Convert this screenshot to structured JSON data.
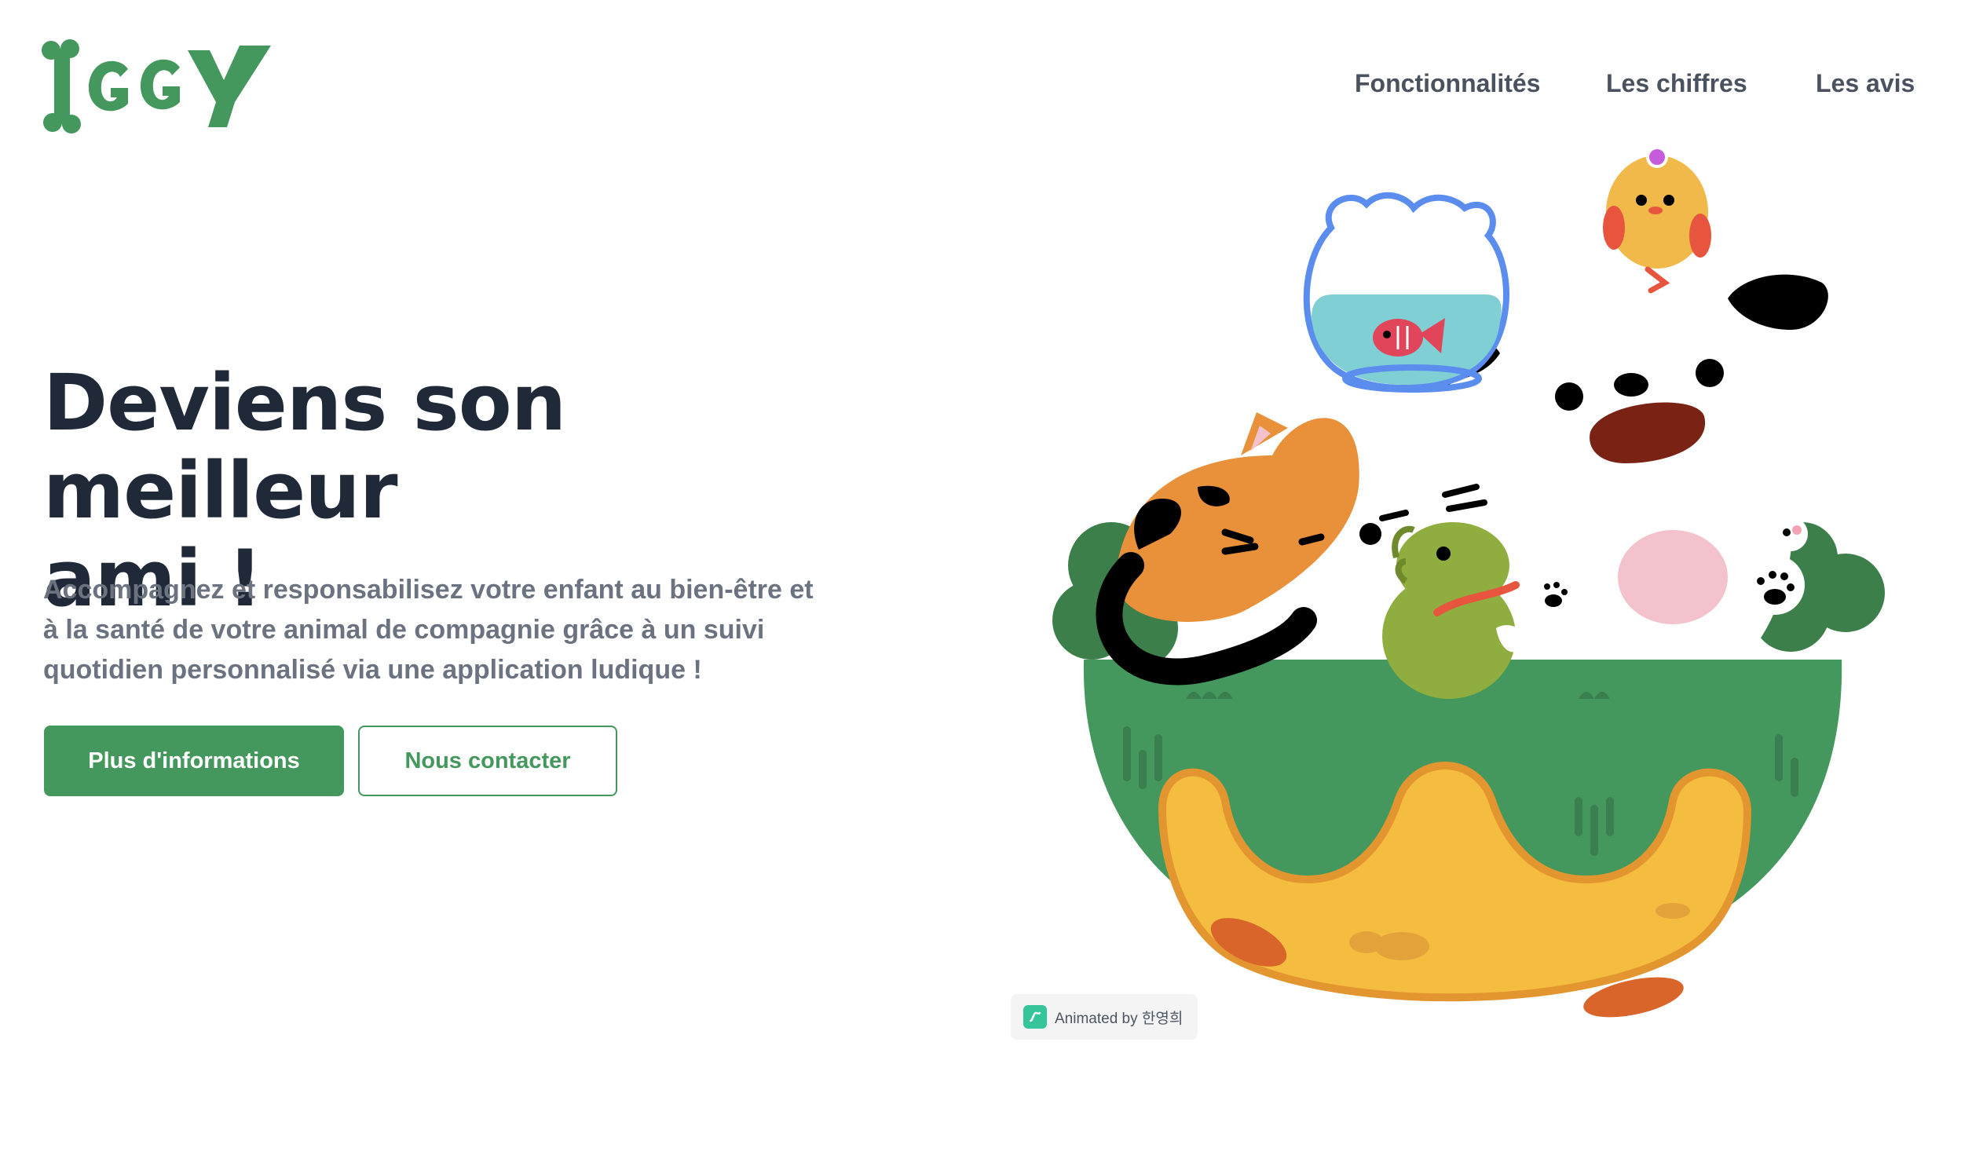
{
  "header": {
    "logo_text": "IGGY",
    "nav": [
      {
        "label": "Fonctionnalités"
      },
      {
        "label": "Les chiffres"
      },
      {
        "label": "Les avis"
      }
    ]
  },
  "hero": {
    "title_line1": "Deviens son meilleur",
    "title_line2": "ami !",
    "subtitle_line1": "Accompagnez et responsabilisez votre enfant au bien-être et",
    "subtitle_line2": "à la santé de votre animal de compagnie grâce à un suivi",
    "subtitle_line3": "quotidien personnalisé via une application ludique !",
    "primary_button": "Plus d'informations",
    "secondary_button": "Nous contacter"
  },
  "illustration": {
    "credit": "Animated by 한영희",
    "credit_icon": "lottie-icon"
  },
  "colors": {
    "brand_green": "#44975d",
    "title": "#1f2937",
    "text": "#6b7280",
    "nav": "#4a5260",
    "bowl_yellow": "#f4bd3f",
    "cat_orange": "#e8913a"
  }
}
